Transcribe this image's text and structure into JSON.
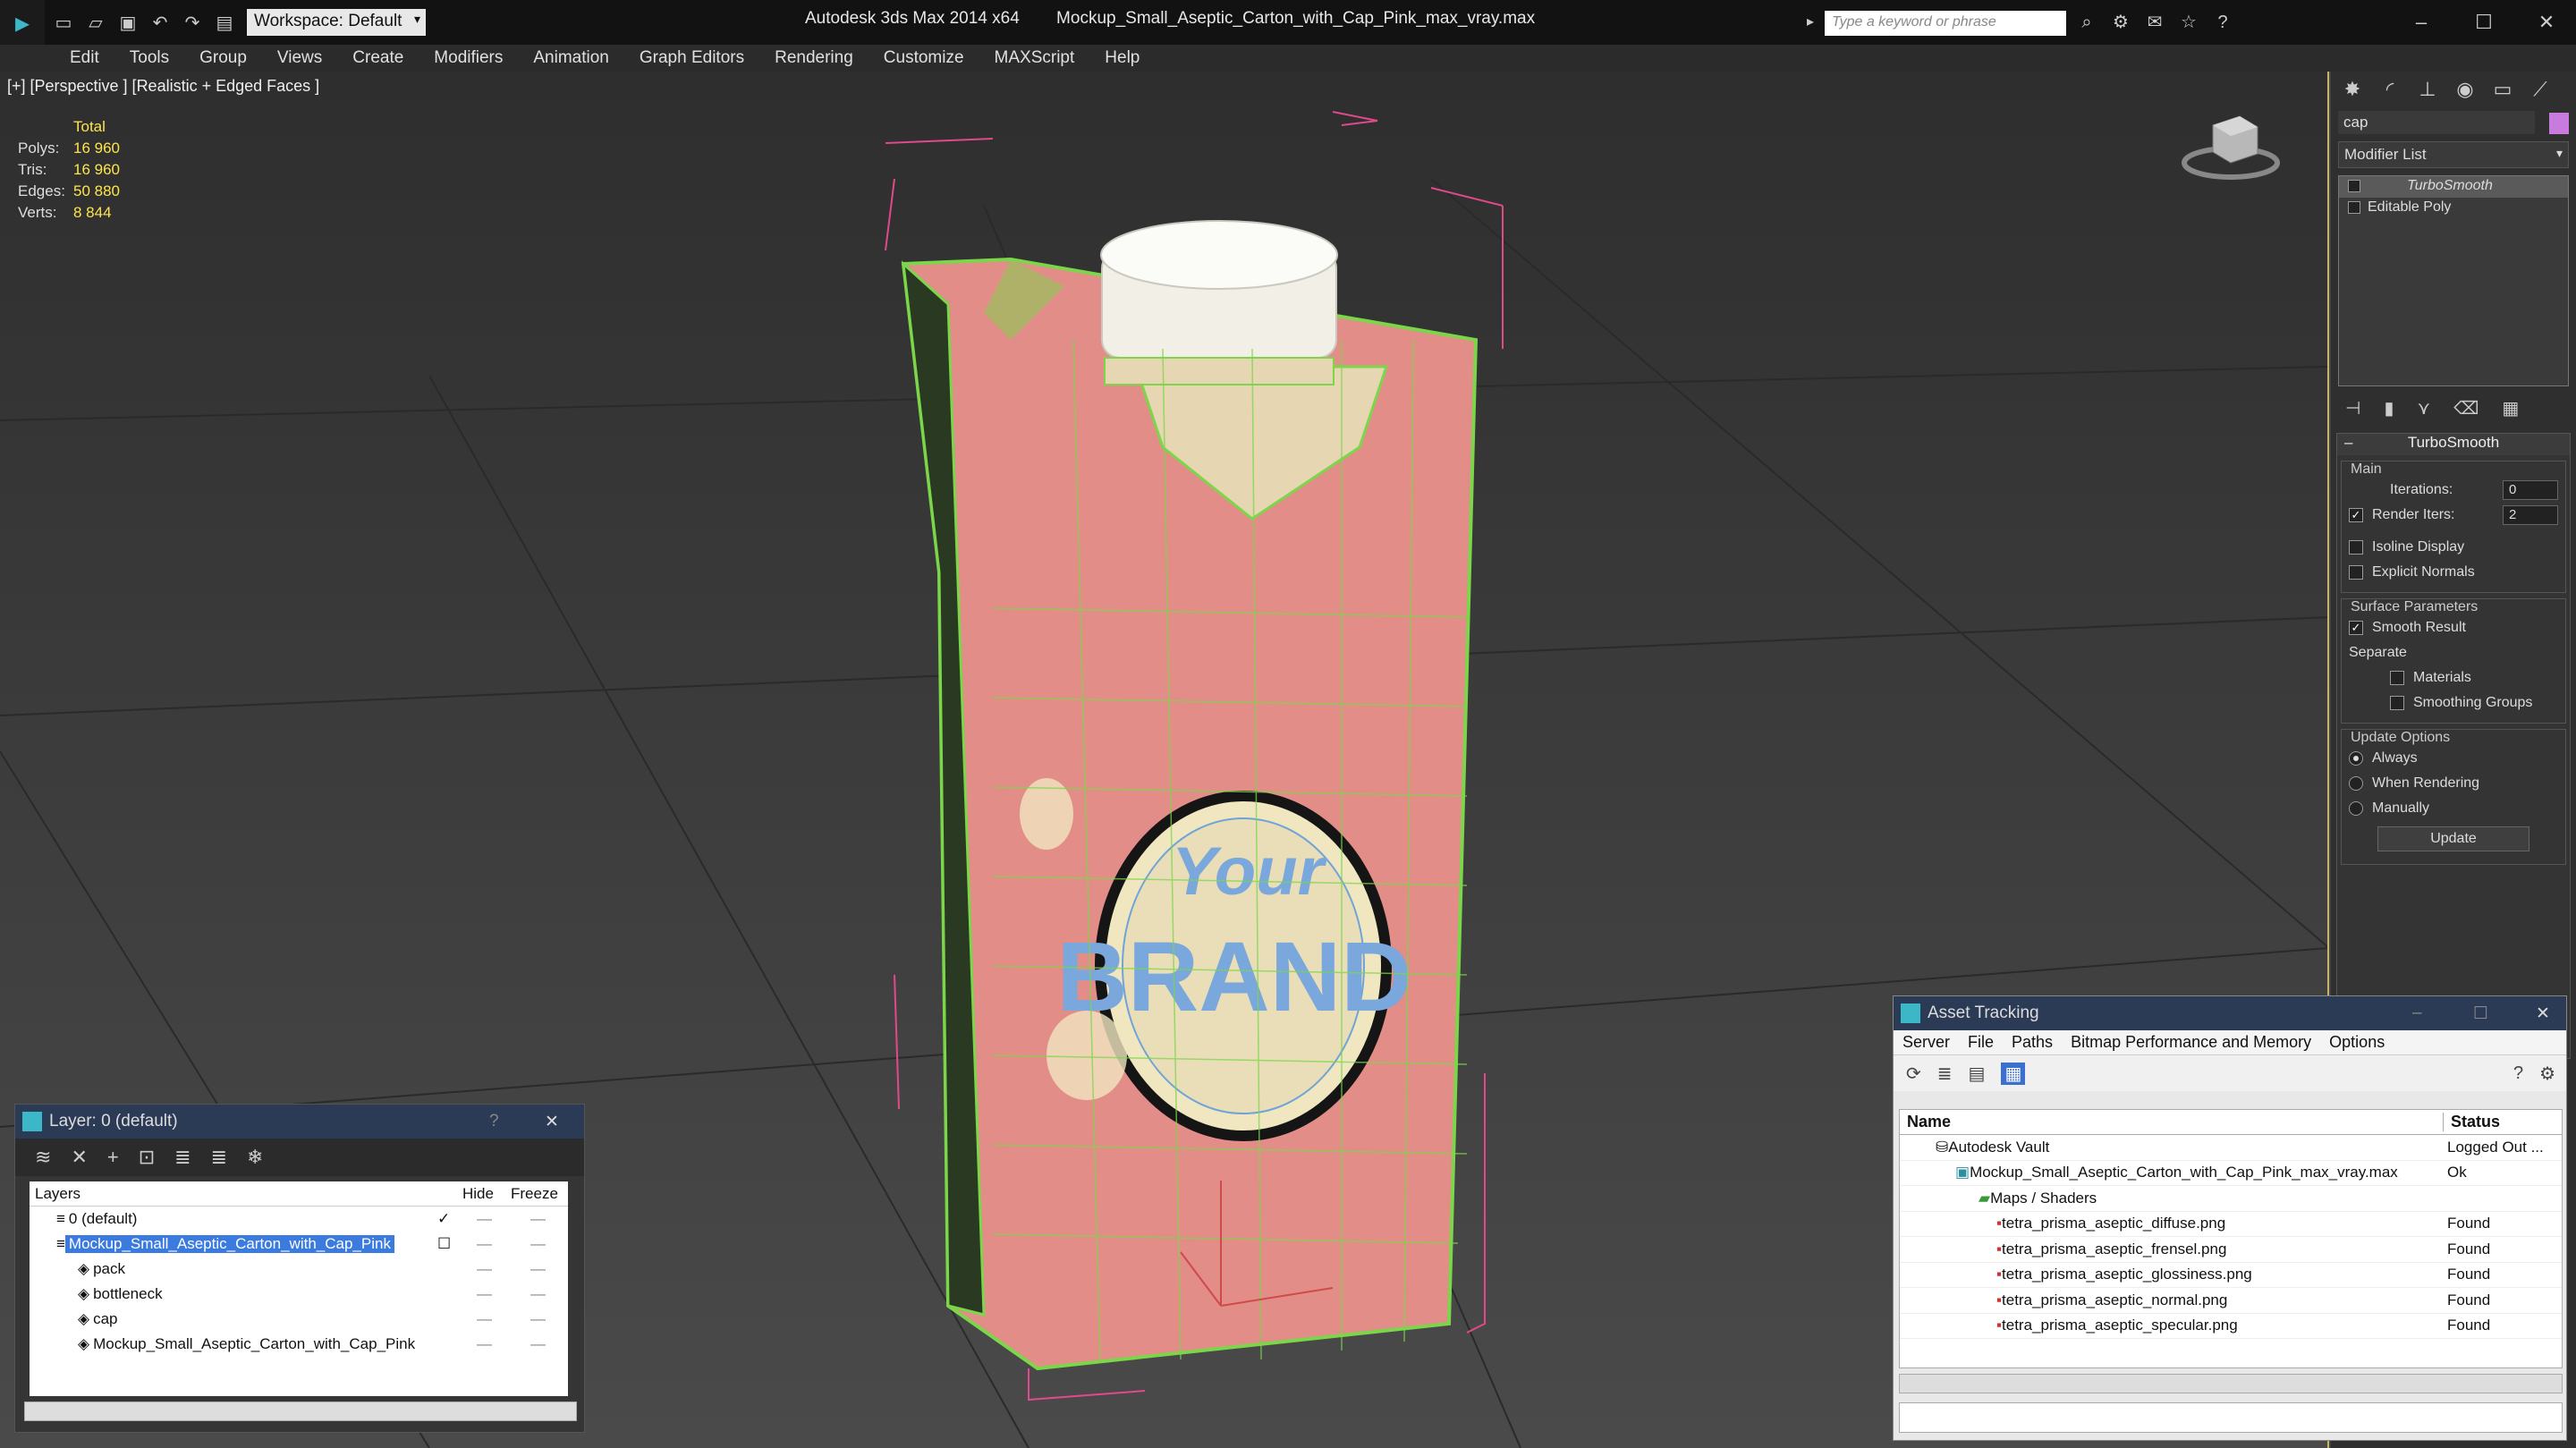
{
  "titlebar": {
    "workspace": "Workspace: Default",
    "app_title": "Autodesk 3ds Max  2014 x64",
    "file_title": "Mockup_Small_Aseptic_Carton_with_Cap_Pink_max_vray.max",
    "search_placeholder": "Type a keyword or phrase"
  },
  "menubar": [
    "Edit",
    "Tools",
    "Group",
    "Views",
    "Create",
    "Modifiers",
    "Animation",
    "Graph Editors",
    "Rendering",
    "Customize",
    "MAXScript",
    "Help"
  ],
  "viewport": {
    "label": "[+] [Perspective ] [Realistic + Edged Faces ]",
    "stats_header": "Total",
    "stats": [
      {
        "k": "Polys:",
        "v": "16 960"
      },
      {
        "k": "Tris:",
        "v": "16 960"
      },
      {
        "k": "Edges:",
        "v": "50 880"
      },
      {
        "k": "Verts:",
        "v": "8 844"
      }
    ],
    "label_art": "Your BRAND"
  },
  "command_panel": {
    "object_name": "cap",
    "modifier_list": "Modifier List",
    "stack": [
      "TurboSmooth",
      "Editable Poly"
    ],
    "rollout_title": "TurboSmooth",
    "main_group": "Main",
    "iterations_label": "Iterations:",
    "iterations_value": "0",
    "render_iters_label": "Render Iters:",
    "render_iters_value": "2",
    "isoline": "Isoline Display",
    "explicit_normals": "Explicit Normals",
    "surface_group": "Surface Parameters",
    "smooth_result": "Smooth Result",
    "separate": "Separate",
    "materials": "Materials",
    "smoothing_groups": "Smoothing Groups",
    "update_group": "Update Options",
    "always": "Always",
    "when_rendering": "When Rendering",
    "manually": "Manually",
    "update_btn": "Update"
  },
  "layer_panel": {
    "title": "Layer: 0 (default)",
    "help": "?",
    "col_layers": "Layers",
    "col_hide": "Hide",
    "col_freeze": "Freeze",
    "rows": [
      {
        "name": "0 (default)",
        "indent": 0
      },
      {
        "name": "Mockup_Small_Aseptic_Carton_with_Cap_Pink",
        "indent": 0
      },
      {
        "name": "pack",
        "indent": 1
      },
      {
        "name": "bottleneck",
        "indent": 1
      },
      {
        "name": "cap",
        "indent": 1
      },
      {
        "name": "Mockup_Small_Aseptic_Carton_with_Cap_Pink",
        "indent": 1
      }
    ]
  },
  "asset_panel": {
    "title": "Asset Tracking",
    "menu": [
      "Server",
      "File",
      "Paths",
      "Bitmap Performance and Memory",
      "Options"
    ],
    "col_name": "Name",
    "col_status": "Status",
    "rows": [
      {
        "name": "Autodesk Vault",
        "status": "Logged Out ...",
        "indent": 1
      },
      {
        "name": "Mockup_Small_Aseptic_Carton_with_Cap_Pink_max_vray.max",
        "status": "Ok",
        "indent": 2
      },
      {
        "name": "Maps / Shaders",
        "status": "",
        "indent": 3
      },
      {
        "name": "tetra_prisma_aseptic_diffuse.png",
        "status": "Found",
        "indent": 4
      },
      {
        "name": "tetra_prisma_aseptic_frensel.png",
        "status": "Found",
        "indent": 4
      },
      {
        "name": "tetra_prisma_aseptic_glossiness.png",
        "status": "Found",
        "indent": 4
      },
      {
        "name": "tetra_prisma_aseptic_normal.png",
        "status": "Found",
        "indent": 4
      },
      {
        "name": "tetra_prisma_aseptic_specular.png",
        "status": "Found",
        "indent": 4
      }
    ]
  }
}
